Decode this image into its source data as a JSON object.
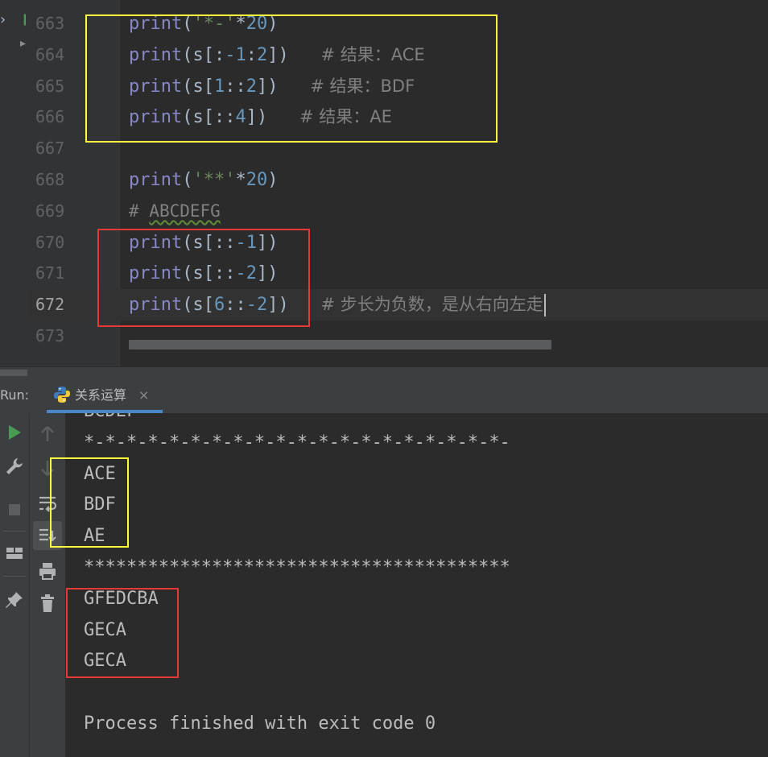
{
  "editor": {
    "lines": [
      {
        "num": "663",
        "tokens": [
          [
            "kw",
            "print"
          ],
          [
            "p",
            "("
          ],
          [
            "str",
            "'*-'"
          ],
          [
            "p",
            "*"
          ],
          [
            "num",
            "20"
          ],
          [
            "p",
            ")"
          ]
        ]
      },
      {
        "num": "664",
        "tokens": [
          [
            "kw",
            "print"
          ],
          [
            "p",
            "(s[:"
          ],
          [
            "num",
            "-1"
          ],
          [
            "p",
            ":"
          ],
          [
            "num",
            "2"
          ],
          [
            "p",
            "])"
          ],
          [
            "sp",
            "   "
          ],
          [
            "cmt",
            "# 结果：ACE"
          ]
        ]
      },
      {
        "num": "665",
        "tokens": [
          [
            "kw",
            "print"
          ],
          [
            "p",
            "(s["
          ],
          [
            "num",
            "1"
          ],
          [
            "p",
            "::"
          ],
          [
            "num",
            "2"
          ],
          [
            "p",
            "])"
          ],
          [
            "sp",
            "   "
          ],
          [
            "cmt",
            "# 结果：BDF"
          ]
        ]
      },
      {
        "num": "666",
        "tokens": [
          [
            "kw",
            "print"
          ],
          [
            "p",
            "(s[::"
          ],
          [
            "num",
            "4"
          ],
          [
            "p",
            "])"
          ],
          [
            "sp",
            "   "
          ],
          [
            "cmt",
            "# 结果：AE"
          ]
        ]
      },
      {
        "num": "667",
        "tokens": []
      },
      {
        "num": "668",
        "tokens": [
          [
            "kw",
            "print"
          ],
          [
            "p",
            "("
          ],
          [
            "str",
            "'**'"
          ],
          [
            "p",
            "*"
          ],
          [
            "num",
            "20"
          ],
          [
            "p",
            ")"
          ]
        ]
      },
      {
        "num": "669",
        "tokens": [
          [
            "cmtmono",
            "# "
          ],
          [
            "sq",
            "ABCDEFG"
          ]
        ]
      },
      {
        "num": "670",
        "tokens": [
          [
            "kw",
            "print"
          ],
          [
            "p",
            "(s[::"
          ],
          [
            "num",
            "-1"
          ],
          [
            "p",
            "])"
          ]
        ]
      },
      {
        "num": "671",
        "tokens": [
          [
            "kw",
            "print"
          ],
          [
            "p",
            "(s[::"
          ],
          [
            "num",
            "-2"
          ],
          [
            "p",
            "])"
          ]
        ]
      },
      {
        "num": "672",
        "tokens": [
          [
            "kw",
            "print"
          ],
          [
            "p",
            "(s["
          ],
          [
            "num",
            "6"
          ],
          [
            "p",
            "::"
          ],
          [
            "num",
            "-2"
          ],
          [
            "p",
            "])"
          ],
          [
            "sp",
            "   "
          ],
          [
            "cmt",
            "# 步长为负数，是从右向左走"
          ],
          [
            "caret",
            ""
          ]
        ],
        "current": true
      },
      {
        "num": "673",
        "tokens": []
      }
    ]
  },
  "run_panel": {
    "label": "Run:",
    "tab_title": "关系运算",
    "close_glyph": "×",
    "output": [
      "BCDEF",
      "*-*-*-*-*-*-*-*-*-*-*-*-*-*-*-*-*-*-*-*-",
      "ACE",
      "BDF",
      "AE",
      "****************************************",
      "GFEDCBA",
      "GECA",
      "GECA",
      "",
      "Process finished with exit code 0"
    ]
  },
  "colors": {
    "highlight_yellow": "#ffff3c",
    "highlight_red": "#e53935",
    "accent_blue": "#4a88c7",
    "run_green": "#499c54"
  }
}
